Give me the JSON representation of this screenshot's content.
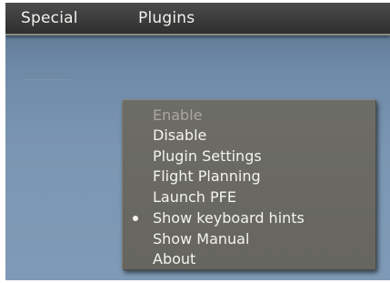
{
  "menubar": {
    "items": [
      {
        "label": "Special"
      },
      {
        "label": "Plugins"
      }
    ]
  },
  "dropdown": {
    "items": [
      {
        "label": "Enable",
        "state": "disabled"
      },
      {
        "label": "Disable",
        "state": "enabled"
      },
      {
        "label": "Plugin Settings",
        "state": "enabled"
      },
      {
        "label": "Flight Planning",
        "state": "enabled"
      },
      {
        "label": "Launch PFE",
        "state": "enabled"
      },
      {
        "label": "Show keyboard hints",
        "state": "checked"
      },
      {
        "label": "Show Manual",
        "state": "enabled"
      },
      {
        "label": "About",
        "state": "enabled"
      }
    ]
  }
}
